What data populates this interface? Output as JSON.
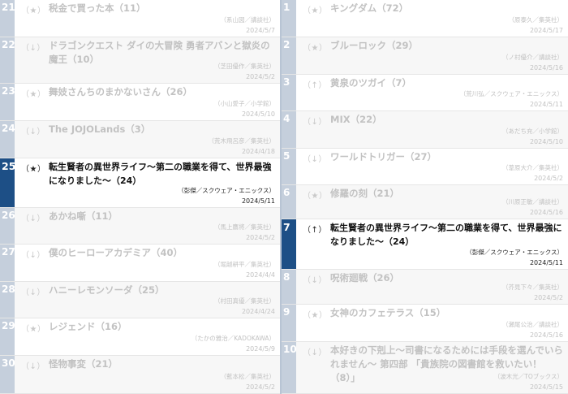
{
  "left_column": [
    {
      "rank": "21",
      "trend": "（★）",
      "title": "税金で買った本（11）",
      "publisher": "（系山図／講談社）",
      "date": "2024/5/7"
    },
    {
      "rank": "22",
      "trend": "（↓）",
      "title": "ドラゴンクエスト ダイの大冒険 勇者アバンと獄炎の魔王（10）",
      "publisher": "（芝田優作／集英社）",
      "date": "2024/5/2"
    },
    {
      "rank": "23",
      "trend": "（★）",
      "title": "舞妓さんちのまかないさん（26）",
      "publisher": "（小山愛子／小学館）",
      "date": "2024/5/10"
    },
    {
      "rank": "24",
      "trend": "（↓）",
      "title": "The JOJOLands（3）",
      "publisher": "（荒木飛呂彦／集英社）",
      "date": "2024/4/18"
    },
    {
      "rank": "25",
      "trend": "（★）",
      "title": "転生賢者の異世界ライフ～第二の職業を得て、世界最強になりました～（24）",
      "publisher": "（彭傑／スクウェア・エニックス）",
      "date": "2024/5/11"
    },
    {
      "rank": "26",
      "trend": "（↓）",
      "title": "あかね噺（11）",
      "publisher": "（馬上鷹将／集英社）",
      "date": "2024/5/2"
    },
    {
      "rank": "27",
      "trend": "（↓）",
      "title": "僕のヒーローアカデミア（40）",
      "publisher": "（堀越耕平／集英社）",
      "date": "2024/4/4"
    },
    {
      "rank": "28",
      "trend": "（↓）",
      "title": "ハニーレモンソーダ（25）",
      "publisher": "（村田真優／集英社）",
      "date": "2024/4/24"
    },
    {
      "rank": "29",
      "trend": "（★）",
      "title": "レジェンド（16）",
      "publisher": "（たかの雅治／KADOKAWA）",
      "date": "2024/5/9"
    },
    {
      "rank": "30",
      "trend": "（↓）",
      "title": "怪物事変（21）",
      "publisher": "（藍本松／集英社）",
      "date": "2024/5/2"
    }
  ],
  "right_column": [
    {
      "rank": "1",
      "trend": "（★）",
      "title": "キングダム（72）",
      "publisher": "（原泰久／集英社）",
      "date": "2024/5/17"
    },
    {
      "rank": "2",
      "trend": "（★）",
      "title": "ブルーロック（29）",
      "publisher": "（ノ村優介／講談社）",
      "date": "2024/5/16"
    },
    {
      "rank": "3",
      "trend": "（↑）",
      "title": "黄泉のツガイ（7）",
      "publisher": "（荒川弘／スクウェア・エニックス）",
      "date": "2024/5/11"
    },
    {
      "rank": "4",
      "trend": "（↓）",
      "title": "MIX（22）",
      "publisher": "（あだち充／小学館）",
      "date": "2024/5/10"
    },
    {
      "rank": "5",
      "trend": "（↓）",
      "title": "ワールドトリガー（27）",
      "publisher": "（葦原大介／集英社）",
      "date": "2024/5/2"
    },
    {
      "rank": "6",
      "trend": "（★）",
      "title": "修羅の刻（21）",
      "publisher": "（川原正敏／講談社）",
      "date": "2024/5/16"
    },
    {
      "rank": "7",
      "trend": "（↑）",
      "title": "転生賢者の異世界ライフ～第二の職業を得て、世界最強になりました～（24）",
      "publisher": "（彭傑／スクウェア・エニックス）",
      "date": "2024/5/11"
    },
    {
      "rank": "8",
      "trend": "（↓）",
      "title": "呪術廻戦（26）",
      "publisher": "（芥見下々／集英社）",
      "date": "2024/5/2"
    },
    {
      "rank": "9",
      "trend": "（★）",
      "title": "女神のカフェテラス（15）",
      "publisher": "（瀬尾公治／講談社）",
      "date": "2024/5/16"
    },
    {
      "rank": "10",
      "trend": "（↓）",
      "title": "本好きの下剋上～司書になるためには手段を選んでいられません～ 第四部 「貴族院の図書館を救いたい！（8）」",
      "publisher": "（波木光／TOブックス）",
      "date": "2024/5/15"
    }
  ]
}
